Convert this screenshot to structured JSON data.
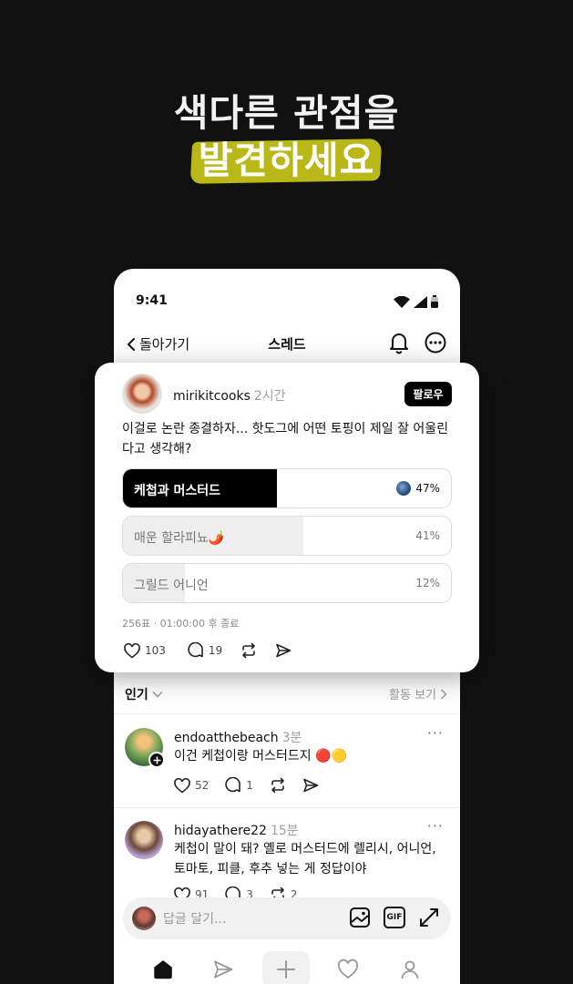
{
  "promo": {
    "headline_line1": "색다른 관점을",
    "headline_line2": "발견하세요",
    "highlight_color": "#d8d51a"
  },
  "status_bar": {
    "time": "9:41"
  },
  "nav": {
    "back_label": "돌아가기",
    "title": "스레드",
    "bell_icon": "bell-icon",
    "more_icon": "more-circle-icon"
  },
  "post": {
    "username": "mirikitcooks",
    "time": "2시간",
    "follow_label": "팔로우",
    "question": "이걸로 논란 종결하자... 핫도그에 어떤 토핑이 제일 잘 어울린다고 생각해?",
    "poll": {
      "options": [
        {
          "label": "케첩과 머스터드",
          "percent_label": "47%",
          "percent": 47,
          "selected": true
        },
        {
          "label": "매운 할라피뇨🌶️",
          "percent_label": "41%",
          "percent": 41,
          "selected": false
        },
        {
          "label": "그릴드 어니언",
          "percent_label": "12%",
          "percent": 12,
          "selected": false
        }
      ],
      "meta": "256표 · 01:00:00 후 종료"
    },
    "likes": "103",
    "comments": "19"
  },
  "sort": {
    "left_label": "인기",
    "right_label": "활동 보기"
  },
  "replies": [
    {
      "username": "endoatthebeach",
      "time": "3분",
      "text": "이건 케첩이랑 머스터드지 🔴🟡",
      "likes": "52",
      "comments": "1"
    },
    {
      "username": "hidayathere22",
      "time": "15분",
      "text": "케첩이 말이 돼? 옐로 머스터드에 렐리시, 어니언, 토마토, 피클, 후추 넣는 게 정답이야",
      "likes": "91",
      "comments": "3",
      "reposts": "2"
    }
  ],
  "composer": {
    "placeholder": "답글 달기...",
    "gif_label": "GIF"
  },
  "tabbar": {
    "items": [
      "home-icon",
      "send-icon",
      "plus-icon",
      "heart-icon",
      "profile-icon"
    ]
  }
}
